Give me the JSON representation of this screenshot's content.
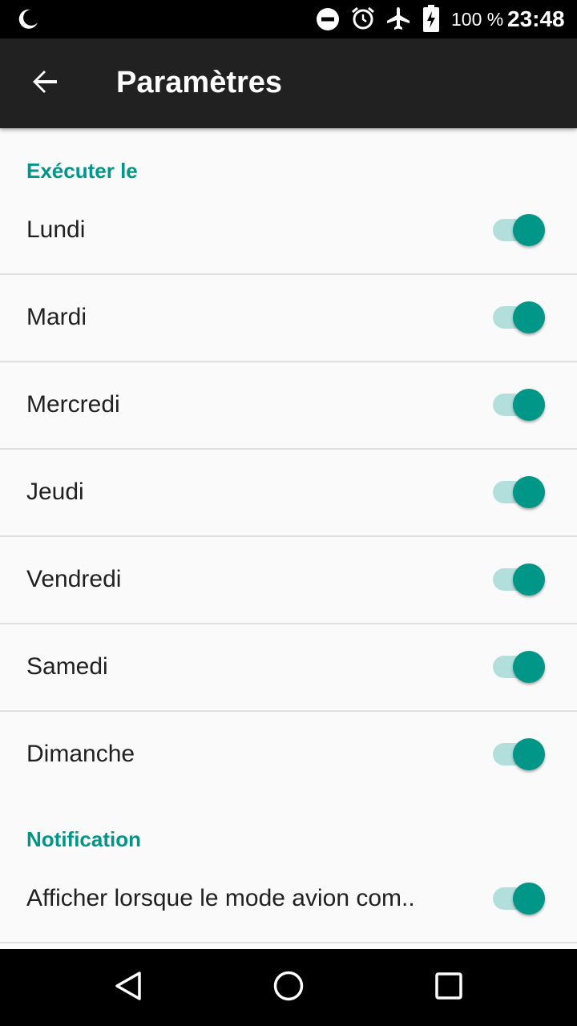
{
  "status_bar": {
    "icons": [
      "moon-icon",
      "do-not-disturb-icon",
      "alarm-icon",
      "airplane-icon",
      "battery-charging-icon"
    ],
    "battery": "100 %",
    "time": "23:48"
  },
  "toolbar": {
    "back_icon": "arrow-left-icon",
    "title": "Paramètres"
  },
  "sections": [
    {
      "header": "Exécuter le",
      "items": [
        {
          "label": "Lundi",
          "enabled": true
        },
        {
          "label": "Mardi",
          "enabled": true
        },
        {
          "label": "Mercredi",
          "enabled": true
        },
        {
          "label": "Jeudi",
          "enabled": true
        },
        {
          "label": "Vendredi",
          "enabled": true
        },
        {
          "label": "Samedi",
          "enabled": true
        },
        {
          "label": "Dimanche",
          "enabled": true
        }
      ]
    },
    {
      "header": "Notification",
      "items": [
        {
          "label": "Afficher lorsque le mode avion com..",
          "enabled": true
        }
      ]
    }
  ],
  "nav_bar": {
    "icons": [
      "back-triangle-icon",
      "home-circle-icon",
      "recents-square-icon"
    ]
  },
  "colors": {
    "accent": "#009688",
    "track": "#b2dfdb",
    "toolbar": "#212121",
    "background": "#fafafa"
  }
}
